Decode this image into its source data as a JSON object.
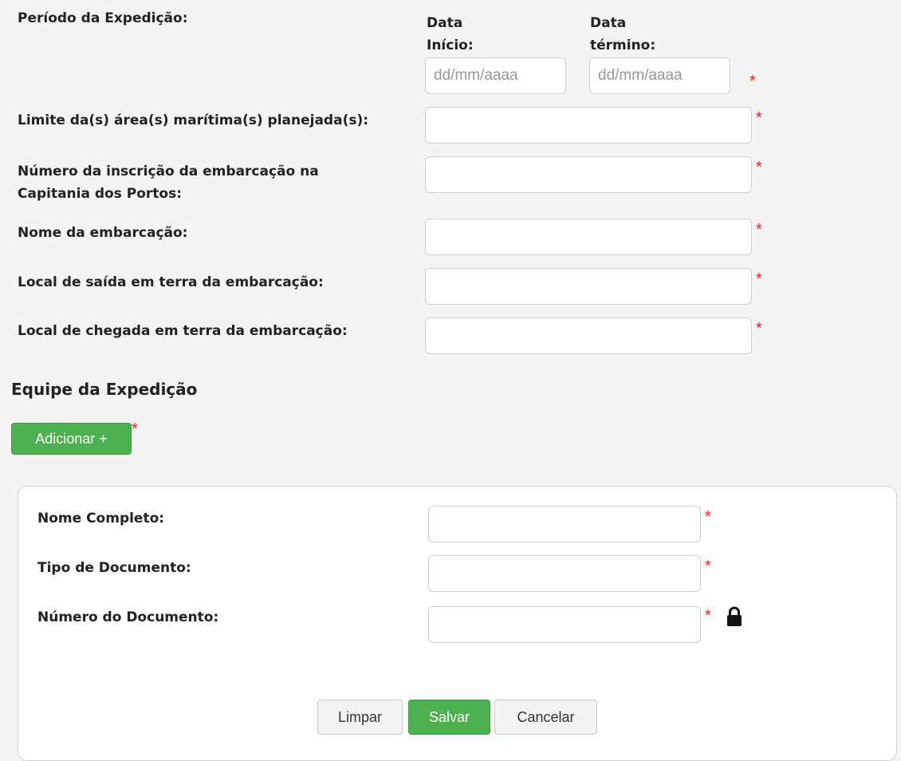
{
  "expedition": {
    "period_label": "Período da Expedição:",
    "start_label_1": "Data",
    "start_label_2": "Início:",
    "end_label_1": "Data",
    "end_label_2": "término:",
    "start_placeholder": "dd/mm/aaaa",
    "end_placeholder": "dd/mm/aaaa",
    "required_mark": "*",
    "fields": [
      {
        "label": "Limite da(s) área(s) marítima(s) planejada(s):"
      },
      {
        "label_line1": "Número da inscrição da embarcação na",
        "label_line2": "Capitania dos Portos:"
      },
      {
        "label": "Nome da embarcação:"
      },
      {
        "label": "Local de saída em terra da embarcação:"
      },
      {
        "label": "Local de chegada em terra da embarcação:"
      }
    ]
  },
  "team": {
    "title": "Equipe da Expedição",
    "add_button": "Adicionar +",
    "form": {
      "full_name_label": "Nome Completo:",
      "doc_type_label": "Tipo de Documento:",
      "doc_number_label": "Número do Documento:"
    },
    "buttons": {
      "clear": "Limpar",
      "save": "Salvar",
      "cancel": "Cancelar"
    }
  },
  "colors": {
    "required": "#e22222",
    "primary_green": "#4db14f"
  },
  "icons": [
    "lock-icon"
  ]
}
